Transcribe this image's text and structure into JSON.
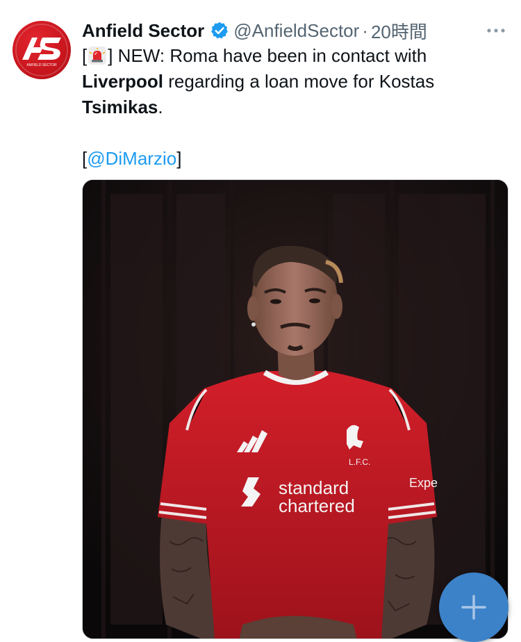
{
  "tweet": {
    "author": {
      "display_name": "Anfield Sector",
      "handle": "@AnfieldSector",
      "avatar_text": "AS",
      "avatar_subtext": "ANFIELD SECTOR",
      "verified": true
    },
    "separator": "·",
    "time": "20時間",
    "text": {
      "line1_open": "[",
      "siren_icon": "police-siren-emoji",
      "line1_rest": "] NEW: Roma have been in contact with",
      "line2_bold": "Liverpool",
      "line2_rest": " regarding a loan move for Kostas",
      "line3_bold": "Tsimikas",
      "line3_rest": ".",
      "line5_open": "[",
      "mention": "@DiMarzio",
      "line5_close": "]"
    },
    "media": {
      "shirt_text_1": "standard",
      "shirt_text_2": "chartered",
      "crest_text": "L.F.C.",
      "sleeve_text": "Expe"
    }
  },
  "fab": {
    "icon": "plus-icon",
    "color": "#3c82c8"
  },
  "colors": {
    "text": "#0f1419",
    "secondary": "#536471",
    "link": "#1d9bf0",
    "verified": "#1d9bf0",
    "brand_red": "#c8151d"
  }
}
